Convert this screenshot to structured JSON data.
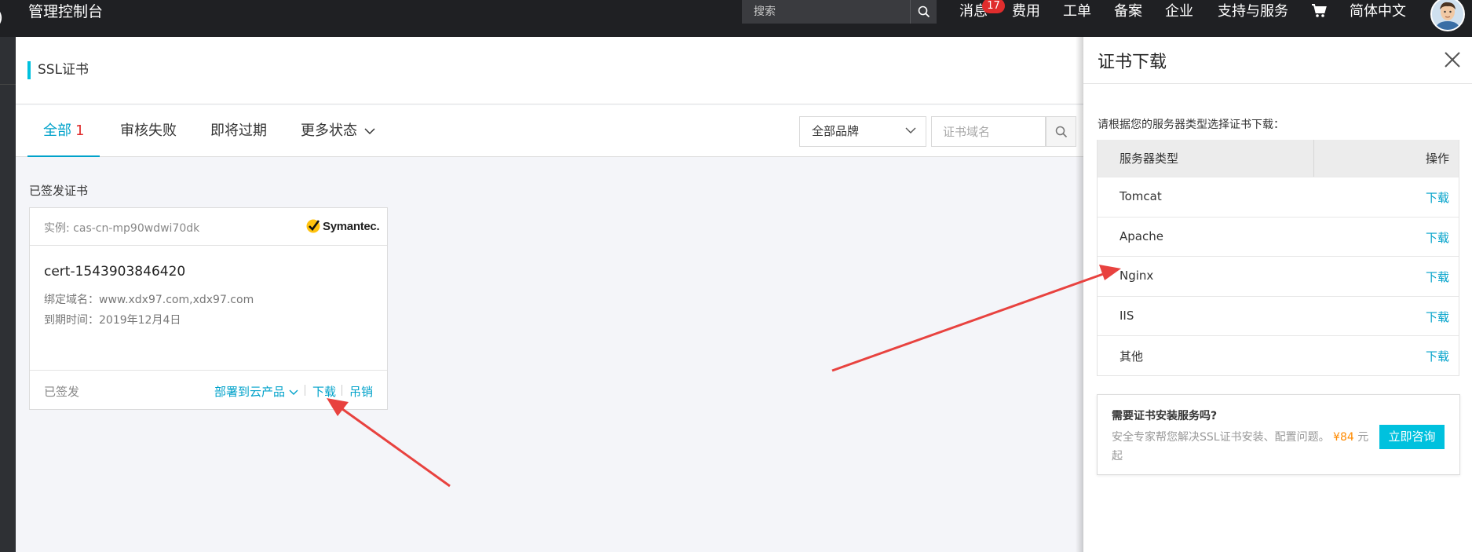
{
  "topbar": {
    "app_title": "管理控制台",
    "search_placeholder": "搜索",
    "message_label": "消息",
    "message_count": "17",
    "nav": [
      "费用",
      "工单",
      "备案",
      "企业",
      "支持与服务"
    ],
    "language": "简体中文"
  },
  "page": {
    "title": "SSL证书"
  },
  "tabs": {
    "all_label": "全部",
    "all_count": "1",
    "review_failed": "审核失败",
    "expiring": "即将过期",
    "more_status": "更多状态"
  },
  "filters": {
    "brand_value": "全部品牌",
    "domain_placeholder": "证书域名"
  },
  "section": {
    "issued_label": "已签发证书"
  },
  "cert_card": {
    "instance": "实例: cas-cn-mp90wdwi70dk",
    "brand": "Symantec.",
    "name": "cert-1543903846420",
    "bound_domains": "绑定域名：www.xdx97.com,xdx97.com",
    "expiry": "到期时间：2019年12月4日",
    "status": "已签发",
    "deploy_label": "部署到云产品",
    "download_label": "下载",
    "revoke_label": "吊销"
  },
  "drawer": {
    "title": "证书下载",
    "hint": "请根据您的服务器类型选择证书下载：",
    "col_server": "服务器类型",
    "col_action": "操作",
    "rows": [
      {
        "server": "Tomcat",
        "action": "下载"
      },
      {
        "server": "Apache",
        "action": "下载"
      },
      {
        "server": "Nginx",
        "action": "下载"
      },
      {
        "server": "IIS",
        "action": "下载"
      },
      {
        "server": "其他",
        "action": "下载"
      }
    ],
    "promo": {
      "title": "需要证书安装服务吗?",
      "desc_prefix": "安全专家帮您解决SSL证书安装、配置问题。",
      "price": "¥84",
      "desc_suffix": "元起",
      "cta": "立即咨询"
    }
  },
  "colors": {
    "accent": "#00a2ca",
    "cta": "#00c1de",
    "badge": "#e02d2d",
    "price": "#ff8a00",
    "arrow": "#e8423f",
    "topbar": "#1f2023"
  }
}
